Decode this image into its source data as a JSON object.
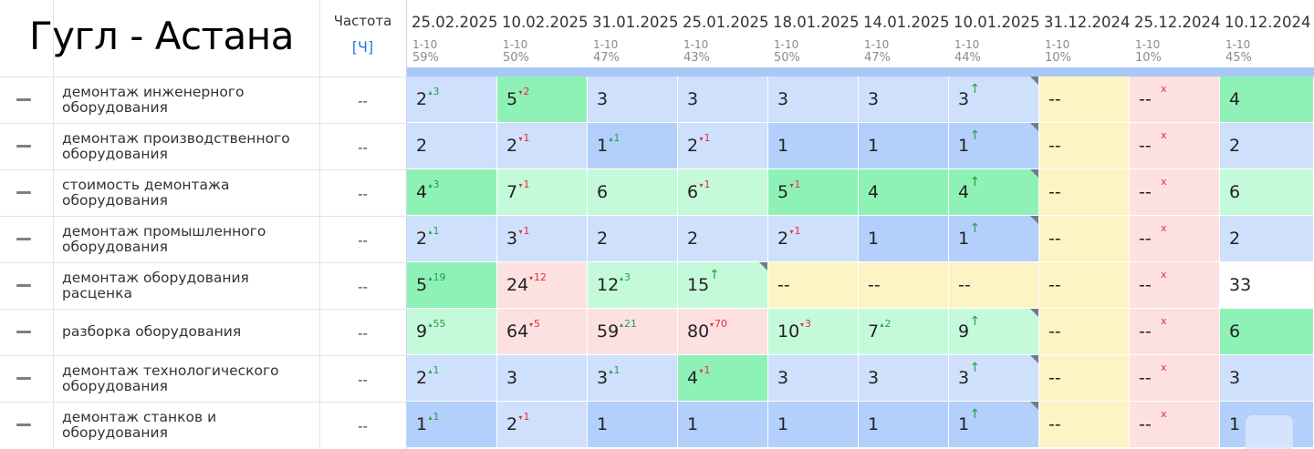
{
  "title": "Гугл - Астана",
  "freq_header": "Частота",
  "freq_link": "[Ч]",
  "dates": [
    {
      "date": "25.02.2025",
      "range": "1-10",
      "pct": "59%"
    },
    {
      "date": "10.02.2025",
      "range": "1-10",
      "pct": "50%"
    },
    {
      "date": "31.01.2025",
      "range": "1-10",
      "pct": "47%"
    },
    {
      "date": "25.01.2025",
      "range": "1-10",
      "pct": "43%"
    },
    {
      "date": "18.01.2025",
      "range": "1-10",
      "pct": "50%"
    },
    {
      "date": "14.01.2025",
      "range": "1-10",
      "pct": "47%"
    },
    {
      "date": "10.01.2025",
      "range": "1-10",
      "pct": "44%"
    },
    {
      "date": "31.12.2024",
      "range": "1-10",
      "pct": "10%"
    },
    {
      "date": "25.12.2024",
      "range": "1-10",
      "pct": "10%"
    },
    {
      "date": "10.12.2024",
      "range": "1-10",
      "pct": "45%"
    }
  ],
  "rows": [
    {
      "keyword": "демонтаж инженерного оборудования",
      "freq": "--",
      "cells": [
        {
          "v": "2",
          "c": "3",
          "dir": "up",
          "bg": "bl"
        },
        {
          "v": "5",
          "c": "2",
          "dir": "down",
          "bg": "gr"
        },
        {
          "v": "3",
          "c": "",
          "dir": "",
          "bg": "bl"
        },
        {
          "v": "3",
          "c": "",
          "dir": "",
          "bg": "bl"
        },
        {
          "v": "3",
          "c": "",
          "dir": "",
          "bg": "bl"
        },
        {
          "v": "3",
          "c": "",
          "dir": "",
          "bg": "bl"
        },
        {
          "v": "3",
          "c": "",
          "dir": "arrow",
          "bg": "bl",
          "corner": true
        },
        {
          "v": "--",
          "c": "",
          "dir": "",
          "bg": "ye"
        },
        {
          "v": "--",
          "c": "x",
          "dir": "x",
          "bg": "pk"
        },
        {
          "v": "4",
          "c": "",
          "dir": "",
          "bg": "gr"
        }
      ]
    },
    {
      "keyword": "демонтаж производственного оборудования",
      "freq": "--",
      "cells": [
        {
          "v": "2",
          "c": "",
          "dir": "",
          "bg": "bl"
        },
        {
          "v": "2",
          "c": "1",
          "dir": "down",
          "bg": "bl"
        },
        {
          "v": "1",
          "c": "1",
          "dir": "up",
          "bg": "bd"
        },
        {
          "v": "2",
          "c": "1",
          "dir": "down",
          "bg": "bl"
        },
        {
          "v": "1",
          "c": "",
          "dir": "",
          "bg": "bd"
        },
        {
          "v": "1",
          "c": "",
          "dir": "",
          "bg": "bd"
        },
        {
          "v": "1",
          "c": "",
          "dir": "arrow",
          "bg": "bd",
          "corner": true
        },
        {
          "v": "--",
          "c": "",
          "dir": "",
          "bg": "ye"
        },
        {
          "v": "--",
          "c": "x",
          "dir": "x",
          "bg": "pk"
        },
        {
          "v": "2",
          "c": "",
          "dir": "",
          "bg": "bl"
        }
      ]
    },
    {
      "keyword": "стоимость демонтажа оборудования",
      "freq": "--",
      "cells": [
        {
          "v": "4",
          "c": "3",
          "dir": "up",
          "bg": "gr"
        },
        {
          "v": "7",
          "c": "1",
          "dir": "down",
          "bg": "gl"
        },
        {
          "v": "6",
          "c": "",
          "dir": "",
          "bg": "gl"
        },
        {
          "v": "6",
          "c": "1",
          "dir": "down",
          "bg": "gl"
        },
        {
          "v": "5",
          "c": "1",
          "dir": "down",
          "bg": "gr"
        },
        {
          "v": "4",
          "c": "",
          "dir": "",
          "bg": "gr"
        },
        {
          "v": "4",
          "c": "",
          "dir": "arrow",
          "bg": "gr",
          "corner": true
        },
        {
          "v": "--",
          "c": "",
          "dir": "",
          "bg": "ye"
        },
        {
          "v": "--",
          "c": "x",
          "dir": "x",
          "bg": "pk"
        },
        {
          "v": "6",
          "c": "",
          "dir": "",
          "bg": "gl"
        }
      ]
    },
    {
      "keyword": "демонтаж промышленного оборудования",
      "freq": "--",
      "cells": [
        {
          "v": "2",
          "c": "1",
          "dir": "up",
          "bg": "bl"
        },
        {
          "v": "3",
          "c": "1",
          "dir": "down",
          "bg": "bl"
        },
        {
          "v": "2",
          "c": "",
          "dir": "",
          "bg": "bl"
        },
        {
          "v": "2",
          "c": "",
          "dir": "",
          "bg": "bl"
        },
        {
          "v": "2",
          "c": "1",
          "dir": "down",
          "bg": "bl"
        },
        {
          "v": "1",
          "c": "",
          "dir": "",
          "bg": "bd"
        },
        {
          "v": "1",
          "c": "",
          "dir": "arrow",
          "bg": "bd",
          "corner": true
        },
        {
          "v": "--",
          "c": "",
          "dir": "",
          "bg": "ye"
        },
        {
          "v": "--",
          "c": "x",
          "dir": "x",
          "bg": "pk"
        },
        {
          "v": "2",
          "c": "",
          "dir": "",
          "bg": "bl"
        }
      ]
    },
    {
      "keyword": "демонтаж оборудования расценка",
      "freq": "--",
      "cells": [
        {
          "v": "5",
          "c": "19",
          "dir": "up",
          "bg": "gr"
        },
        {
          "v": "24",
          "c": "12",
          "dir": "down",
          "bg": "pk"
        },
        {
          "v": "12",
          "c": "3",
          "dir": "up",
          "bg": "gl"
        },
        {
          "v": "15",
          "c": "",
          "dir": "arrow",
          "bg": "gl",
          "corner": true
        },
        {
          "v": "--",
          "c": "",
          "dir": "",
          "bg": "ye"
        },
        {
          "v": "--",
          "c": "",
          "dir": "",
          "bg": "ye"
        },
        {
          "v": "--",
          "c": "",
          "dir": "",
          "bg": "ye"
        },
        {
          "v": "--",
          "c": "",
          "dir": "",
          "bg": "ye"
        },
        {
          "v": "--",
          "c": "x",
          "dir": "x",
          "bg": "pk"
        },
        {
          "v": "33",
          "c": "",
          "dir": "",
          "bg": "wh"
        }
      ]
    },
    {
      "keyword": "разборка оборудования",
      "freq": "--",
      "cells": [
        {
          "v": "9",
          "c": "55",
          "dir": "up",
          "bg": "gl"
        },
        {
          "v": "64",
          "c": "5",
          "dir": "down",
          "bg": "pk"
        },
        {
          "v": "59",
          "c": "21",
          "dir": "up",
          "bg": "pk"
        },
        {
          "v": "80",
          "c": "70",
          "dir": "down",
          "bg": "pk"
        },
        {
          "v": "10",
          "c": "3",
          "dir": "down",
          "bg": "gl"
        },
        {
          "v": "7",
          "c": "2",
          "dir": "up",
          "bg": "gl"
        },
        {
          "v": "9",
          "c": "",
          "dir": "arrow",
          "bg": "gl",
          "corner": true
        },
        {
          "v": "--",
          "c": "",
          "dir": "",
          "bg": "ye"
        },
        {
          "v": "--",
          "c": "x",
          "dir": "x",
          "bg": "pk"
        },
        {
          "v": "6",
          "c": "",
          "dir": "",
          "bg": "gr"
        }
      ]
    },
    {
      "keyword": "демонтаж технологического оборудования",
      "freq": "--",
      "cells": [
        {
          "v": "2",
          "c": "1",
          "dir": "up",
          "bg": "bl"
        },
        {
          "v": "3",
          "c": "",
          "dir": "",
          "bg": "bl"
        },
        {
          "v": "3",
          "c": "1",
          "dir": "up",
          "bg": "bl"
        },
        {
          "v": "4",
          "c": "1",
          "dir": "down",
          "bg": "gr"
        },
        {
          "v": "3",
          "c": "",
          "dir": "",
          "bg": "bl"
        },
        {
          "v": "3",
          "c": "",
          "dir": "",
          "bg": "bl"
        },
        {
          "v": "3",
          "c": "",
          "dir": "arrow",
          "bg": "bl",
          "corner": true
        },
        {
          "v": "--",
          "c": "",
          "dir": "",
          "bg": "ye"
        },
        {
          "v": "--",
          "c": "x",
          "dir": "x",
          "bg": "pk"
        },
        {
          "v": "3",
          "c": "",
          "dir": "",
          "bg": "bl"
        }
      ]
    },
    {
      "keyword": "демонтаж станков и оборудования",
      "freq": "--",
      "cells": [
        {
          "v": "1",
          "c": "1",
          "dir": "up",
          "bg": "bd"
        },
        {
          "v": "2",
          "c": "1",
          "dir": "down",
          "bg": "bl"
        },
        {
          "v": "1",
          "c": "",
          "dir": "",
          "bg": "bd"
        },
        {
          "v": "1",
          "c": "",
          "dir": "",
          "bg": "bd"
        },
        {
          "v": "1",
          "c": "",
          "dir": "",
          "bg": "bd"
        },
        {
          "v": "1",
          "c": "",
          "dir": "",
          "bg": "bd"
        },
        {
          "v": "1",
          "c": "",
          "dir": "arrow",
          "bg": "bd",
          "corner": true
        },
        {
          "v": "--",
          "c": "",
          "dir": "",
          "bg": "ye"
        },
        {
          "v": "--",
          "c": "x",
          "dir": "x",
          "bg": "pk"
        },
        {
          "v": "1",
          "c": "",
          "dir": "",
          "bg": "bd"
        }
      ]
    }
  ]
}
